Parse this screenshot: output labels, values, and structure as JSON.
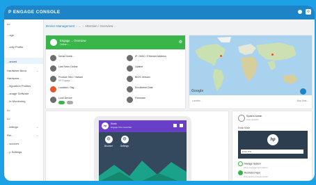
{
  "topbar": {
    "title": "P ENGAGE CONSOLE"
  },
  "sidebar": {
    "items": [
      {
        "label": "Lu"
      },
      {
        "label": "...ogs"
      },
      {
        "label": "...urity Profile"
      },
      {
        "label": "...anced"
      },
      {
        "label": "Hardware Bund"
      },
      {
        "label": "Hardware..."
      },
      {
        "label": "...figuration Profiles"
      },
      {
        "label": "...anage Software"
      },
      {
        "label": "...te Monitoring"
      },
      {
        "label": "Lu"
      },
      {
        "label": "Lu"
      },
      {
        "label": "...tellings"
      },
      {
        "label": "Rei..."
      },
      {
        "label": "...sources"
      },
      {
        "label": "...p Settings"
      }
    ]
  },
  "breadcrumb": {
    "link1": "Device Management",
    "link2": "...",
    "current": "Attention / Overview"
  },
  "device_info": {
    "name": "Engage ... Overview",
    "subtitle": "Online • ... ",
    "fields_left": [
      {
        "label": "Serial Numb...",
        "value": "..."
      },
      {
        "label": "Last Seen Online",
        "value": "..."
      },
      {
        "label": "Product SKU / Variant",
        "value": "HP Engage ... ..."
      },
      {
        "label": "Location / Tag...",
        "value": "..."
      },
      {
        "label": "Lock Device",
        "value": ""
      }
    ],
    "fields_right": [
      {
        "label": "IP / MAC / Ethernet Address",
        "value": "... ... ..."
      },
      {
        "label": "Uptime",
        "value": "..."
      },
      {
        "label": "BIOS Version",
        "value": "..."
      },
      {
        "label": "Enrollment Date",
        "value": "..."
      },
      {
        "label": "Firmware",
        "value": "..."
      }
    ]
  },
  "map": {
    "brand": "Google",
    "footer_left": "Location ...",
    "footer_right": "Map Data ..."
  },
  "tablet": {
    "app_title": "Kiosk",
    "app_subtitle": "Engage One Launcher",
    "tiles": [
      {
        "label": "Browser",
        "icon": "globe-icon"
      },
      {
        "label": "Settings",
        "icon": "globe-icon"
      }
    ]
  },
  "profile_panel": {
    "user": "System Admin",
    "user_sub": "Administrator",
    "section": "Kiosk Mode",
    "input_placeholder": "Enter PIN",
    "options": [
      {
        "label": "Manage System",
        "sub": "Allow management options"
      },
      {
        "label": "Restricted Apps",
        "sub": "Only approved apps shown"
      }
    ]
  },
  "colors": {
    "accent": "#1e84c8",
    "status_green": "#39b54a",
    "app_purple": "#6a3fc7",
    "alert_red": "#e9522c"
  }
}
